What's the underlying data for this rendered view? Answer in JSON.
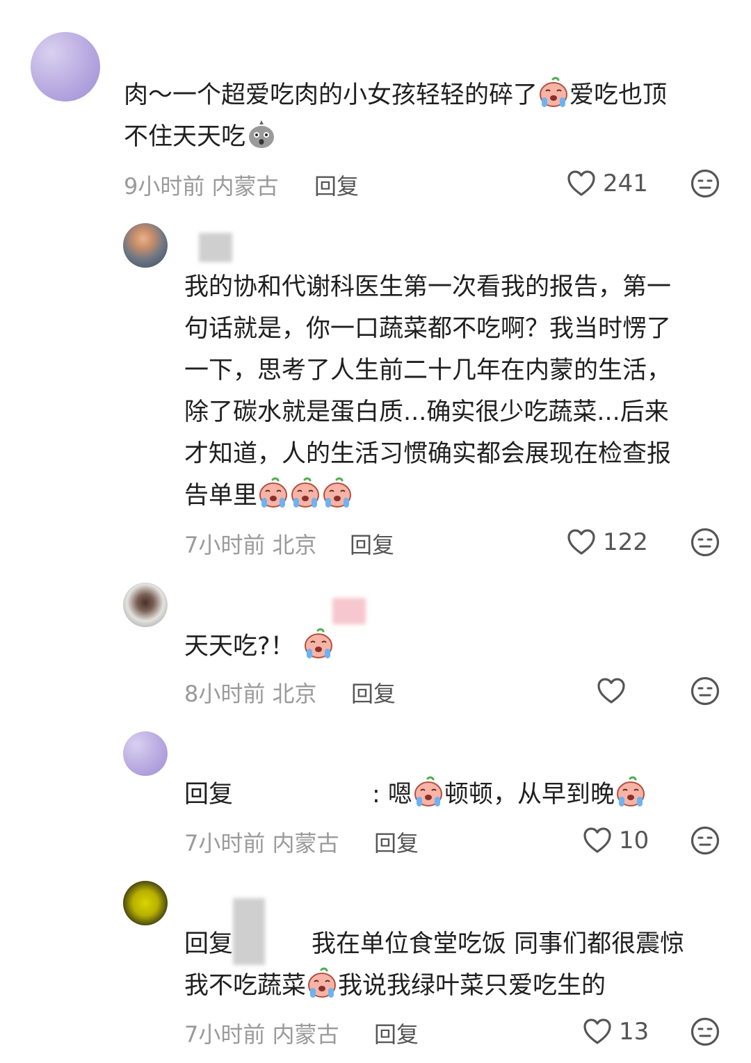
{
  "comments": [
    {
      "text_parts": [
        "肉～一个超爱吃肉的小女孩轻轻的碎了",
        "爱吃也顶",
        "不住天天吃"
      ],
      "time": "9小时前",
      "location": "内蒙古",
      "reply_label": "回复",
      "likes": "241"
    },
    {
      "lines": [
        "我的协和代谢科医生第一次看我的报告，第一",
        "句话就是，你一口蔬菜都不吃啊？我当时愣了",
        "一下，思考了人生前二十几年在内蒙的生活，",
        "除了碳水就是蛋白质...确实很少吃蔬菜...后来",
        "才知道，人的生活习惯确实都会展现在检查报",
        "告单里"
      ],
      "time": "7小时前",
      "location": "北京",
      "reply_label": "回复",
      "likes": "122"
    },
    {
      "text": "天天吃?！",
      "time": "8小时前",
      "location": "北京",
      "reply_label": "回复"
    },
    {
      "prefix": "回复",
      "text_parts": [
        ": 嗯",
        "顿顿，从早到晚"
      ],
      "time": "7小时前",
      "location": "内蒙古",
      "reply_label": "回复",
      "likes": "10"
    },
    {
      "prefix": "回复",
      "line1": "我在单位食堂吃饭 同事们都很震惊",
      "line2_parts": [
        "我不吃蔬菜",
        "我说我绿叶菜只爱吃生的"
      ],
      "time": "7小时前",
      "location": "内蒙古",
      "reply_label": "回复",
      "likes": "13"
    }
  ],
  "icons": {
    "like": "heart-outline-icon",
    "dislike": "neutral-face-icon",
    "emoji_cry": "crying-peach-emoji",
    "emoji_shock": "shocked-bag-emoji"
  },
  "colors": {
    "text": "#1f1f1f",
    "meta": "#9a9a9a",
    "icon": "#555555"
  }
}
